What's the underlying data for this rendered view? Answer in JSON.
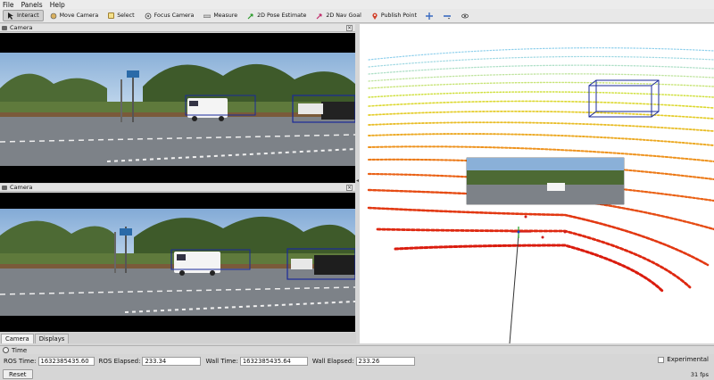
{
  "menubar": {
    "items": [
      "File",
      "Panels",
      "Help"
    ]
  },
  "toolbar": {
    "tools": [
      {
        "label": "Interact",
        "icon": "cursor-icon",
        "active": true
      },
      {
        "label": "Move Camera",
        "icon": "move-camera-icon",
        "active": false
      },
      {
        "label": "Select",
        "icon": "select-icon",
        "active": false
      },
      {
        "label": "Focus Camera",
        "icon": "focus-camera-icon",
        "active": false
      },
      {
        "label": "Measure",
        "icon": "ruler-icon",
        "active": false
      },
      {
        "label": "2D Pose Estimate",
        "icon": "pose-arrow-icon",
        "active": false
      },
      {
        "label": "2D Nav Goal",
        "icon": "nav-arrow-icon",
        "active": false
      },
      {
        "label": "Publish Point",
        "icon": "pin-icon",
        "active": false
      }
    ],
    "extra_icons": [
      "crosshair-icon",
      "minus-icon",
      "eye-icon"
    ]
  },
  "panels": {
    "camera_top_title": "Camera",
    "camera_bottom_title": "Camera"
  },
  "tabs": [
    "Camera",
    "Displays"
  ],
  "time_panel": {
    "title": "Time",
    "ros_time_label": "ROS Time:",
    "ros_time_value": "1632385435.60",
    "ros_elapsed_label": "ROS Elapsed:",
    "ros_elapsed_value": "233.34",
    "wall_time_label": "Wall Time:",
    "wall_time_value": "1632385435.64",
    "wall_elapsed_label": "Wall Elapsed:",
    "wall_elapsed_value": "233.26",
    "experimental_label": "Experimental"
  },
  "footer": {
    "reset_label": "Reset",
    "fps": "31 fps"
  },
  "colors": {
    "cloud_far": "#7ec8e8",
    "cloud_mid": "#c8e030",
    "cloud_near": "#e02010",
    "bbox": "#1a2a9a"
  }
}
